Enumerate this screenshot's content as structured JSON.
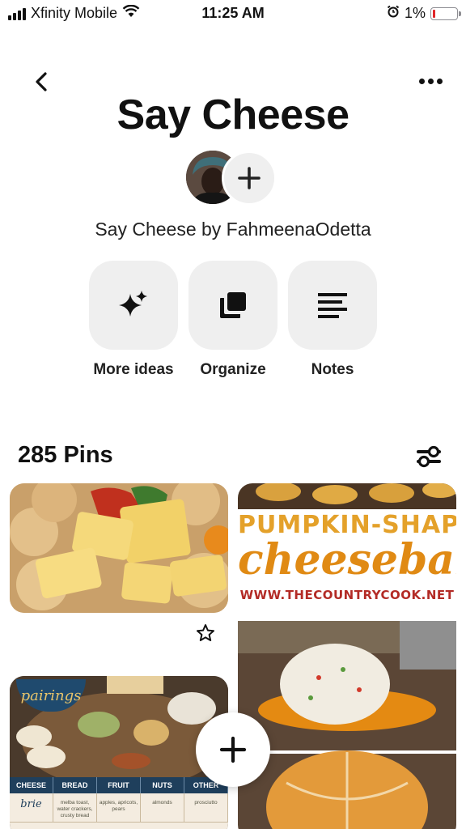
{
  "status_bar": {
    "carrier": "Xfinity Mobile",
    "time": "11:25 AM",
    "battery_percent": "1%",
    "battery_level": 0.01,
    "icons": [
      "signal-icon",
      "wifi-icon",
      "alarm-icon",
      "battery-icon"
    ]
  },
  "header": {
    "back_icon": "chevron-left-icon",
    "more_icon": "ellipsis-icon"
  },
  "board": {
    "title": "Say Cheese",
    "owner_line": "Say Cheese by FahmeenaOdetta",
    "collaborator_icon": "plus-icon"
  },
  "actions": [
    {
      "label": "More ideas",
      "icon": "sparkle-icon"
    },
    {
      "label": "Organize",
      "icon": "organize-icon"
    },
    {
      "label": "Notes",
      "icon": "notes-icon"
    }
  ],
  "pins_section": {
    "count_label": "285 Pins",
    "filter_icon": "filter-sliders-icon"
  },
  "pins": [
    {
      "id": "cheese-crackers",
      "save_icon": "star-icon"
    },
    {
      "id": "pumpkin-cheeseball",
      "title_line_1": "PUMPKIN-SHAPED",
      "title_line_2": "cheeseball",
      "url_text": "WWW.THECOUNTRYCOOK.NET"
    },
    {
      "id": "cheese-pairings",
      "badge": "pairings",
      "table_headers": [
        "CHEESE",
        "BREAD",
        "FRUIT",
        "NUTS",
        "OTHER"
      ],
      "table_row": [
        "brie",
        "melba toast, water crackers, crusty bread",
        "apples, apricots, pears",
        "almonds",
        "prosciutto"
      ]
    }
  ],
  "fab": {
    "icon": "plus-icon"
  },
  "colors": {
    "tile_background": "#efefef",
    "text_primary": "#111111",
    "battery_low": "#e0262a"
  }
}
